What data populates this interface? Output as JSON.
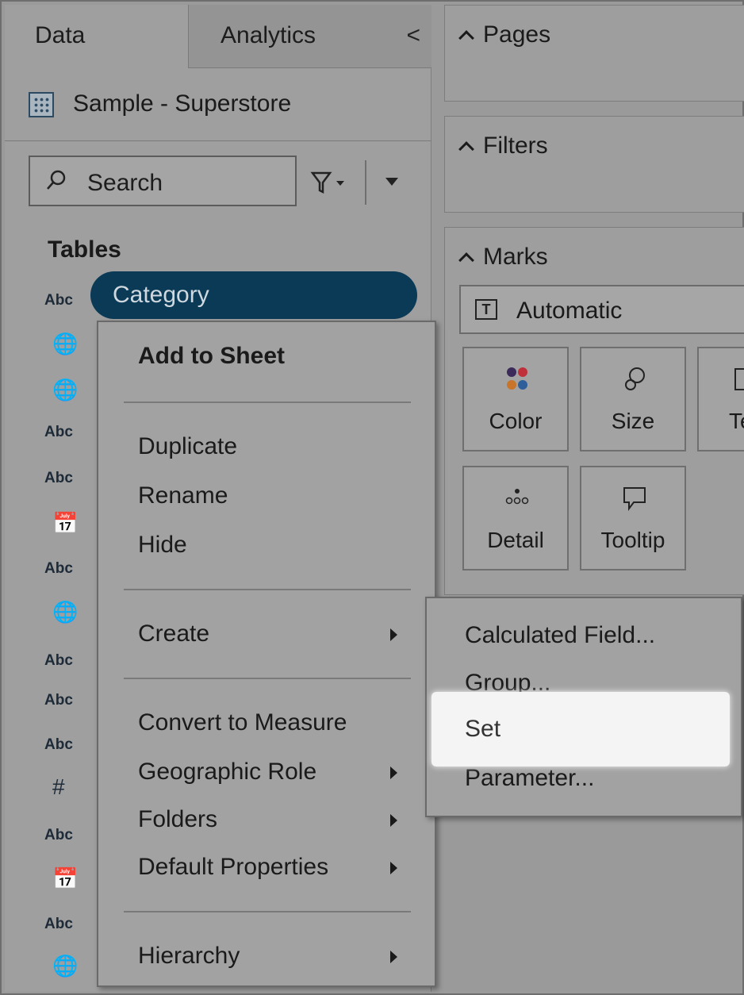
{
  "tabs": {
    "data": "Data",
    "analytics": "Analytics",
    "collapse": "<"
  },
  "datasource": {
    "name": "Sample - Superstore",
    "icon": "datasource-icon"
  },
  "search": {
    "placeholder": "Search"
  },
  "tables_label": "Tables",
  "fields": [
    {
      "icon": "Abc",
      "name": "Category",
      "selected": true
    },
    {
      "icon": "globe"
    },
    {
      "icon": "globe"
    },
    {
      "icon": "Abc"
    },
    {
      "icon": "Abc"
    },
    {
      "icon": "calendar"
    },
    {
      "icon": "Abc"
    },
    {
      "icon": "globe"
    },
    {
      "icon": "Abc"
    },
    {
      "icon": "Abc"
    },
    {
      "icon": "Abc"
    },
    {
      "icon": "#"
    },
    {
      "icon": "Abc"
    },
    {
      "icon": "calendar"
    },
    {
      "icon": "Abc"
    },
    {
      "icon": "globe"
    }
  ],
  "shelves": {
    "pages": "Pages",
    "filters": "Filters",
    "marks": "Marks",
    "mark_type": "Automatic",
    "mark_type_icon": "T",
    "cards": {
      "color": "Color",
      "size": "Size",
      "text": "Text",
      "detail": "Detail",
      "tooltip": "Tooltip"
    }
  },
  "context_menu": {
    "add_to_sheet": "Add to Sheet",
    "duplicate": "Duplicate",
    "rename": "Rename",
    "hide": "Hide",
    "create": "Create",
    "convert": "Convert to Measure",
    "geographic_role": "Geographic Role",
    "folders": "Folders",
    "default_properties": "Default Properties",
    "hierarchy": "Hierarchy"
  },
  "submenu": {
    "calculated_field": "Calculated Field...",
    "group": "Group...",
    "set": "Set",
    "parameter": "Parameter..."
  },
  "colors": {
    "selected_pill": "#0b3a57",
    "highlight": "#f4f4f4"
  }
}
